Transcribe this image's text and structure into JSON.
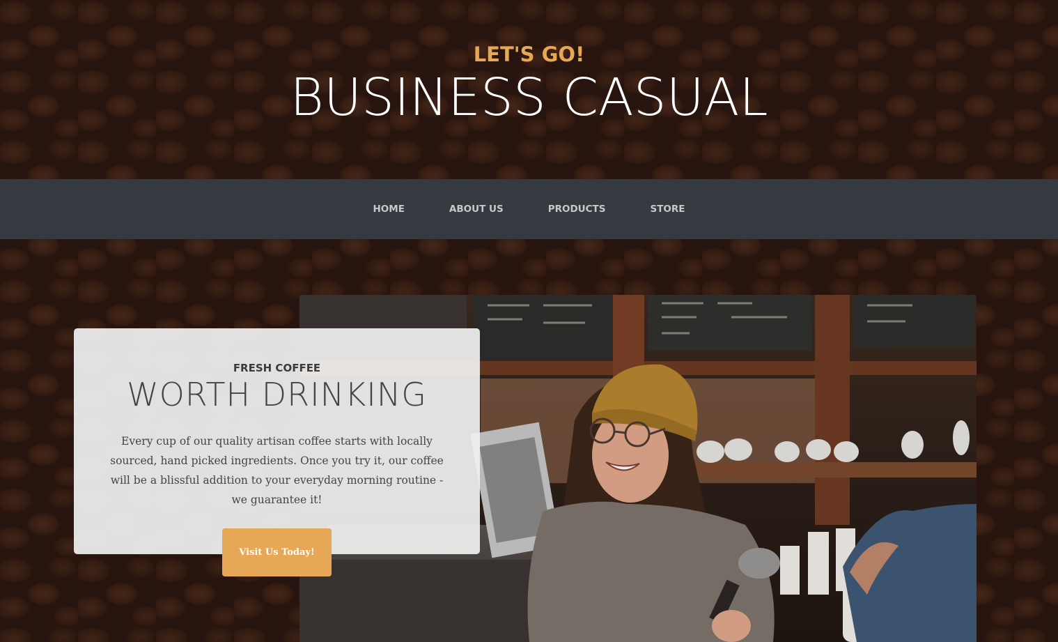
{
  "brand": {
    "upper": "LET'S GO!",
    "main": "BUSINESS CASUAL"
  },
  "navbar": {
    "items": [
      {
        "label": "HOME"
      },
      {
        "label": "ABOUT US"
      },
      {
        "label": "PRODUCTS"
      },
      {
        "label": "STORE"
      }
    ]
  },
  "intro": {
    "upper": "FRESH COFFEE",
    "main": "WORTH DRINKING",
    "text": "Every cup of our quality artisan coffee starts with locally sourced, hand picked ingredients. Once you try it, our coffee will be a blissful addition to your everyday morning routine - we guarantee it!",
    "button_label": "Visit Us Today!"
  },
  "colors": {
    "accent": "#e6a756",
    "navbar_bg": "#343a40",
    "nav_text": "#c8c8c8"
  }
}
